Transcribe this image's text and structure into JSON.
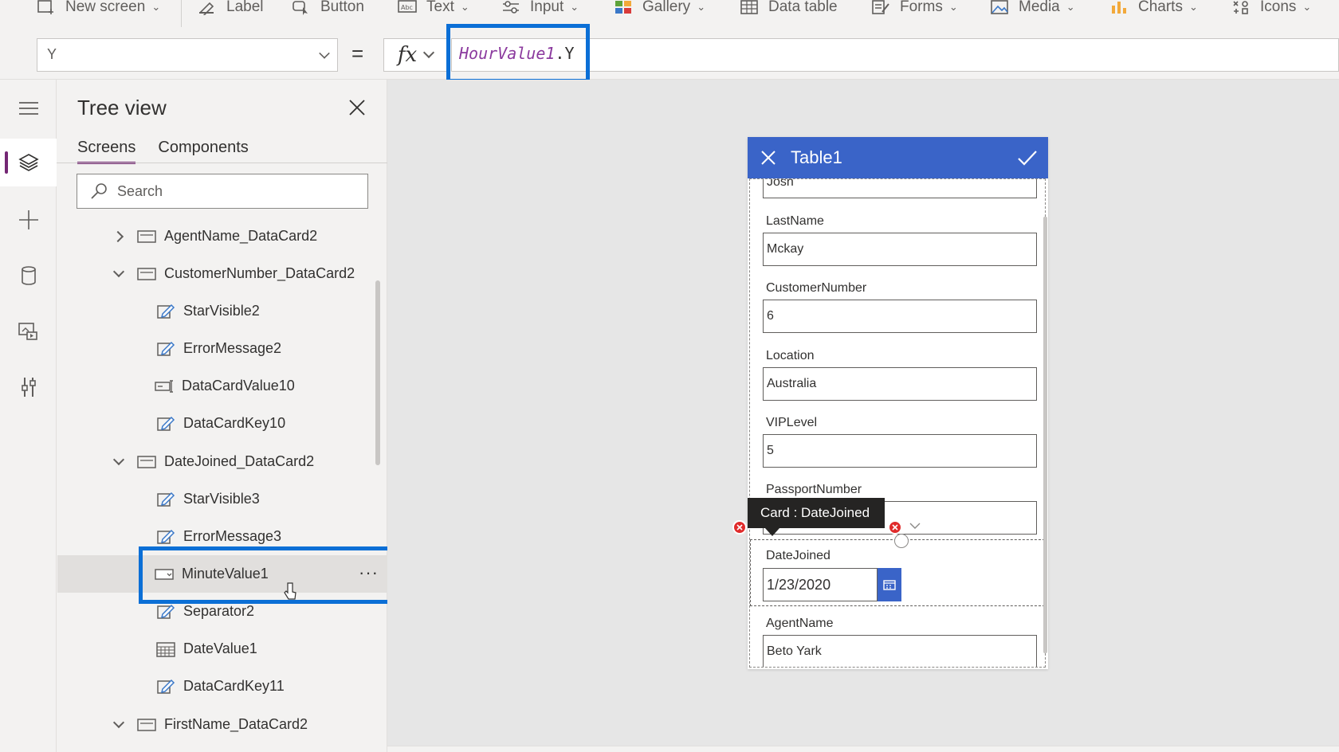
{
  "ribbon": {
    "items": [
      {
        "label": "New screen",
        "icon": "new-screen-icon",
        "dropdown": true
      },
      {
        "label": "Label",
        "icon": "label-icon",
        "dropdown": false
      },
      {
        "label": "Button",
        "icon": "button-icon",
        "dropdown": false
      },
      {
        "label": "Text",
        "icon": "text-icon",
        "dropdown": true
      },
      {
        "label": "Input",
        "icon": "input-icon",
        "dropdown": true
      },
      {
        "label": "Gallery",
        "icon": "gallery-icon",
        "dropdown": true
      },
      {
        "label": "Data table",
        "icon": "data-table-icon",
        "dropdown": false
      },
      {
        "label": "Forms",
        "icon": "forms-icon",
        "dropdown": true
      },
      {
        "label": "Media",
        "icon": "media-icon",
        "dropdown": true
      },
      {
        "label": "Charts",
        "icon": "charts-icon",
        "dropdown": true
      },
      {
        "label": "Icons",
        "icon": "icons-icon",
        "dropdown": true
      }
    ]
  },
  "formula_bar": {
    "property": "Y",
    "equals": "=",
    "fx": "fx",
    "formula_control": "HourValue1",
    "formula_dot": ".",
    "formula_prop": "Y"
  },
  "tree_view": {
    "title": "Tree view",
    "tabs": [
      {
        "label": "Screens",
        "active": true
      },
      {
        "label": "Components",
        "active": false
      }
    ],
    "search_placeholder": "Search",
    "nodes": [
      {
        "label": "AgentName_DataCard2",
        "level": 1,
        "twisty": "right",
        "icon": "card-icon"
      },
      {
        "label": "CustomerNumber_DataCard2",
        "level": 1,
        "twisty": "down",
        "icon": "card-icon"
      },
      {
        "label": "StarVisible2",
        "level": 2,
        "icon": "edit-icon"
      },
      {
        "label": "ErrorMessage2",
        "level": 2,
        "icon": "edit-icon"
      },
      {
        "label": "DataCardValue10",
        "level": 2,
        "icon": "text-input-icon"
      },
      {
        "label": "DataCardKey10",
        "level": 2,
        "icon": "edit-icon"
      },
      {
        "label": "DateJoined_DataCard2",
        "level": 1,
        "twisty": "down",
        "icon": "card-icon"
      },
      {
        "label": "StarVisible3",
        "level": 2,
        "icon": "edit-icon"
      },
      {
        "label": "ErrorMessage3",
        "level": 2,
        "icon": "edit-icon"
      },
      {
        "label": "MinuteValue1",
        "level": 2,
        "icon": "dropdown-icon",
        "selected": true
      },
      {
        "label": "Separator2",
        "level": 2,
        "icon": "edit-icon"
      },
      {
        "label": "DateValue1",
        "level": 2,
        "icon": "calendar-icon"
      },
      {
        "label": "DataCardKey11",
        "level": 2,
        "icon": "edit-icon"
      },
      {
        "label": "FirstName_DataCard2",
        "level": 1,
        "twisty": "down",
        "icon": "card-icon"
      }
    ],
    "more_label": "···"
  },
  "form": {
    "title": "Table1",
    "fields": [
      {
        "label": "",
        "value": "Josh"
      },
      {
        "label": "LastName",
        "value": "Mckay"
      },
      {
        "label": "CustomerNumber",
        "value": "6"
      },
      {
        "label": "Location",
        "value": "Australia"
      },
      {
        "label": "VIPLevel",
        "value": "5"
      },
      {
        "label": "PassportNumber",
        "value": ""
      }
    ],
    "date_field": {
      "label": "DateJoined",
      "value": "1/23/2020"
    },
    "agent_field": {
      "label": "AgentName",
      "value": "Beto Yark"
    },
    "tooltip": "Card : DateJoined"
  },
  "colors": {
    "accent": "#742774",
    "form_header": "#3a64c8",
    "highlight": "#0b6fd6",
    "error_handle": "#e02b2b"
  }
}
